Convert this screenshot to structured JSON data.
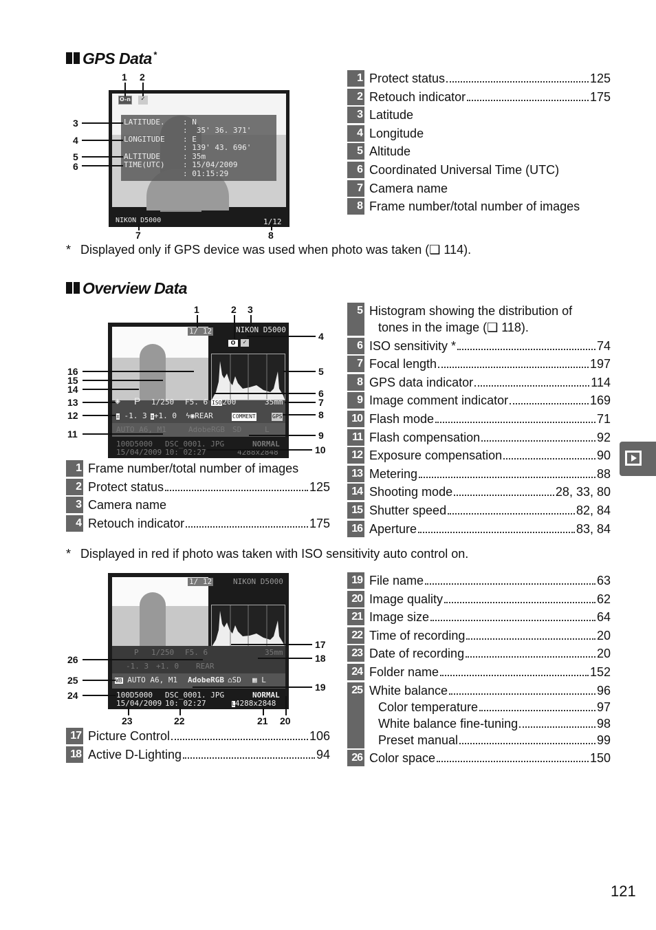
{
  "gps_section": {
    "title": "GPS Data",
    "title_mark": "*",
    "screen": {
      "labels": [
        "LATITUDE.",
        "LONGITUDE",
        "ALTITUDE",
        "TIME(UTC)"
      ],
      "values": [
        "N",
        "35' 36. 371'",
        "E",
        "139' 43. 696'",
        "35m",
        "15/04/2009",
        "01:15:29"
      ],
      "camera_name": "NIKON D5000",
      "frame": "1/12",
      "protect_icon": "O-n",
      "retouch_icon": "✓"
    },
    "callouts": [
      "1",
      "2",
      "3",
      "4",
      "5",
      "6",
      "7",
      "8"
    ],
    "items": [
      {
        "num": "1",
        "label": "Protect status",
        "page": "125"
      },
      {
        "num": "2",
        "label": "Retouch indicator",
        "page": "175"
      },
      {
        "num": "3",
        "label": "Latitude",
        "page": ""
      },
      {
        "num": "4",
        "label": "Longitude",
        "page": ""
      },
      {
        "num": "5",
        "label": "Altitude",
        "page": ""
      },
      {
        "num": "6",
        "label": "Coordinated Universal Time (UTC)",
        "page": ""
      },
      {
        "num": "7",
        "label": "Camera name",
        "page": ""
      },
      {
        "num": "8",
        "label": "Frame number/total number of images",
        "page": ""
      }
    ],
    "footnote": {
      "mark": "*",
      "text": "Displayed only if GPS device was used when photo was taken (❑ 114)."
    }
  },
  "overview_section": {
    "title": "Overview Data",
    "screen": {
      "frame": "1/ 12",
      "camera_name": "NIKON D5000",
      "metering_icon": "◈",
      "mode": "P",
      "shutter": "1/250",
      "aperture": "F5. 6",
      "iso_badge": "ISO",
      "iso": "200",
      "focal": "35mm",
      "exp_comp": "-1. 3",
      "flash_comp": "+1. 0",
      "flash_mode": "REAR",
      "comment": "COMMENT",
      "gps": "GPS",
      "wb": "AUTO A6, M1",
      "color_space": "AdobeRGB",
      "picture_control": "SD",
      "adl": "L",
      "folder": "100D5000",
      "file": "DSC_0001. JPG",
      "quality": "NORMAL",
      "date": "15/04/2009",
      "time": "10: 02:27",
      "size": "4288x2848"
    },
    "callouts_top": [
      "1",
      "2",
      "3",
      "4",
      "5",
      "6",
      "7",
      "8",
      "9",
      "10",
      "11",
      "12",
      "13",
      "14",
      "15",
      "16"
    ],
    "callouts_bottom": [
      "17",
      "18",
      "19",
      "20",
      "21",
      "22",
      "23",
      "24",
      "25",
      "26"
    ],
    "items_left_a": [
      {
        "num": "1",
        "label": "Frame number/total number of images",
        "page": ""
      },
      {
        "num": "2",
        "label": "Protect status",
        "page": "125"
      },
      {
        "num": "3",
        "label": "Camera name",
        "page": ""
      },
      {
        "num": "4",
        "label": "Retouch indicator",
        "page": "175"
      }
    ],
    "items_right_a": [
      {
        "num": "5",
        "label": "Histogram showing the distribution of",
        "label2": "tones in the image (❑ 118).",
        "page": ""
      },
      {
        "num": "6",
        "label": "ISO sensitivity *",
        "page": "74"
      },
      {
        "num": "7",
        "label": "Focal length",
        "page": "197"
      },
      {
        "num": "8",
        "label": "GPS data indicator",
        "page": "114"
      },
      {
        "num": "9",
        "label": "Image comment indicator",
        "page": "169"
      },
      {
        "num": "10",
        "label": "Flash mode",
        "page": "71"
      },
      {
        "num": "11",
        "label": "Flash compensation",
        "page": "92"
      },
      {
        "num": "12",
        "label": "Exposure compensation",
        "page": "90"
      },
      {
        "num": "13",
        "label": "Metering",
        "page": "88"
      },
      {
        "num": "14",
        "label": "Shooting mode",
        "page": "28, 33, 80"
      },
      {
        "num": "15",
        "label": "Shutter speed",
        "page": "82, 84"
      },
      {
        "num": "16",
        "label": "Aperture",
        "page": "83, 84"
      }
    ],
    "footnote": {
      "mark": "*",
      "text": "Displayed in red if photo was taken with ISO sensitivity auto control on."
    },
    "items_left_b": [
      {
        "num": "17",
        "label": "Picture Control",
        "page": "106"
      },
      {
        "num": "18",
        "label": "Active D-Lighting",
        "page": "94"
      }
    ],
    "items_right_b": [
      {
        "num": "19",
        "label": "File name",
        "page": "63"
      },
      {
        "num": "20",
        "label": "Image quality",
        "page": "62"
      },
      {
        "num": "21",
        "label": "Image size",
        "page": "64"
      },
      {
        "num": "22",
        "label": "Time of recording",
        "page": "20"
      },
      {
        "num": "23",
        "label": "Date of recording",
        "page": "20"
      },
      {
        "num": "24",
        "label": "Folder name",
        "page": "152"
      },
      {
        "num": "25",
        "label": "White balance",
        "page": "96",
        "subs": [
          {
            "label": "Color temperature",
            "page": "97"
          },
          {
            "label": "White balance fine-tuning",
            "page": "98"
          },
          {
            "label": "Preset manual",
            "page": "99"
          }
        ]
      },
      {
        "num": "26",
        "label": "Color space",
        "page": "150"
      }
    ]
  },
  "side_tab": {
    "icon": "playback-icon"
  },
  "page_number": "121"
}
